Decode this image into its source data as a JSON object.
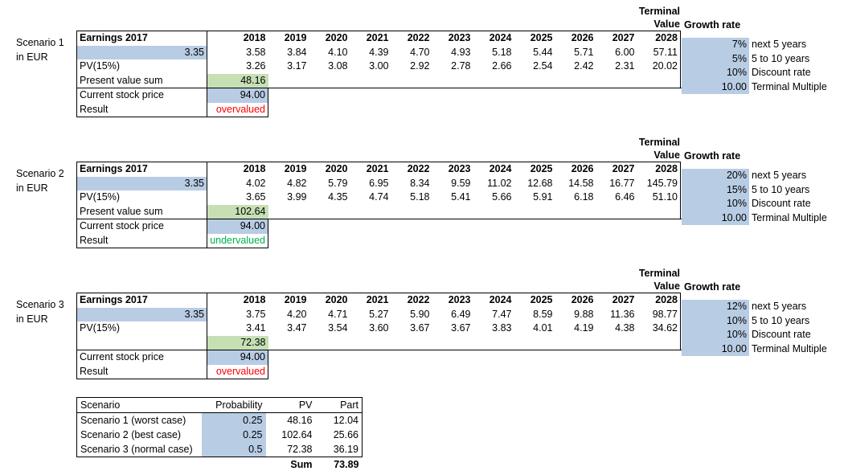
{
  "currency_note": "in EUR",
  "terminal_header": {
    "line1": "Terminal",
    "line2": "Value"
  },
  "growth_header": "Growth rate",
  "columns": {
    "earnings_header": "Earnings 2017",
    "years": [
      "2018",
      "2019",
      "2020",
      "2021",
      "2022",
      "2023",
      "2024",
      "2025",
      "2026",
      "2027",
      "2028"
    ]
  },
  "row_labels": {
    "pv": "PV(15%)",
    "pv_sum": "Present value sum",
    "stock_price": "Current stock price",
    "result": "Result"
  },
  "assumption_labels": {
    "next5": "next 5 years",
    "five_to_ten": "5 to 10 years",
    "discount": "Discount rate",
    "terminal_multiple": "Terminal Multiple"
  },
  "colors": {
    "input_blue": "#b8cce4",
    "output_green": "#c6e0b4",
    "overvalued": "#ff0000",
    "undervalued": "#00b050"
  },
  "scenarios": [
    {
      "name": "Scenario 1",
      "earnings_2017": "3.35",
      "earnings": [
        "3.58",
        "3.84",
        "4.10",
        "4.39",
        "4.70",
        "4.93",
        "5.18",
        "5.44",
        "5.71",
        "6.00",
        "57.11"
      ],
      "pv": [
        "3.26",
        "3.17",
        "3.08",
        "3.00",
        "2.92",
        "2.78",
        "2.66",
        "2.54",
        "2.42",
        "2.31",
        "20.02"
      ],
      "pv_sum_label": "Present value sum",
      "pv_sum": "48.16",
      "stock_price": "94.00",
      "result": "overvalued",
      "result_state": "overvalued",
      "assumptions": {
        "next5": "7%",
        "five_to_ten": "5%",
        "discount": "10%",
        "terminal_multiple": "10.00"
      }
    },
    {
      "name": "Scenario 2",
      "earnings_2017": "3.35",
      "earnings": [
        "4.02",
        "4.82",
        "5.79",
        "6.95",
        "8.34",
        "9.59",
        "11.02",
        "12.68",
        "14.58",
        "16.77",
        "145.79"
      ],
      "pv": [
        "3.65",
        "3.99",
        "4.35",
        "4.74",
        "5.18",
        "5.41",
        "5.66",
        "5.91",
        "6.18",
        "6.46",
        "51.10"
      ],
      "pv_sum_label": "Present value sum",
      "pv_sum": "102.64",
      "stock_price": "94.00",
      "result": "undervalued",
      "result_state": "undervalued",
      "assumptions": {
        "next5": "20%",
        "five_to_ten": "15%",
        "discount": "10%",
        "terminal_multiple": "10.00"
      }
    },
    {
      "name": "Scenario 3",
      "earnings_2017": "3.35",
      "earnings": [
        "3.75",
        "4.20",
        "4.71",
        "5.27",
        "5.90",
        "6.49",
        "7.47",
        "8.59",
        "9.88",
        "11.36",
        "98.77"
      ],
      "pv": [
        "3.41",
        "3.47",
        "3.54",
        "3.60",
        "3.67",
        "3.67",
        "3.83",
        "4.01",
        "4.19",
        "4.38",
        "34.62"
      ],
      "pv_sum_label": "",
      "pv_sum": "72.38",
      "stock_price": "94.00",
      "result": "overvalued",
      "result_state": "overvalued",
      "assumptions": {
        "next5": "12%",
        "five_to_ten": "10%",
        "discount": "10%",
        "terminal_multiple": "10.00"
      }
    }
  ],
  "summary": {
    "headers": [
      "Scenario",
      "Probability",
      "PV",
      "Part"
    ],
    "rows": [
      {
        "scenario": "Scenario 1 (worst case)",
        "probability": "0.25",
        "pv": "48.16",
        "part": "12.04"
      },
      {
        "scenario": "Scenario 2 (best case)",
        "probability": "0.25",
        "pv": "102.64",
        "part": "25.66"
      },
      {
        "scenario": "Scenario 3 (normal case)",
        "probability": "0.5",
        "pv": "72.38",
        "part": "36.19"
      }
    ],
    "sum_label": "Sum",
    "sum_value": "73.89"
  }
}
